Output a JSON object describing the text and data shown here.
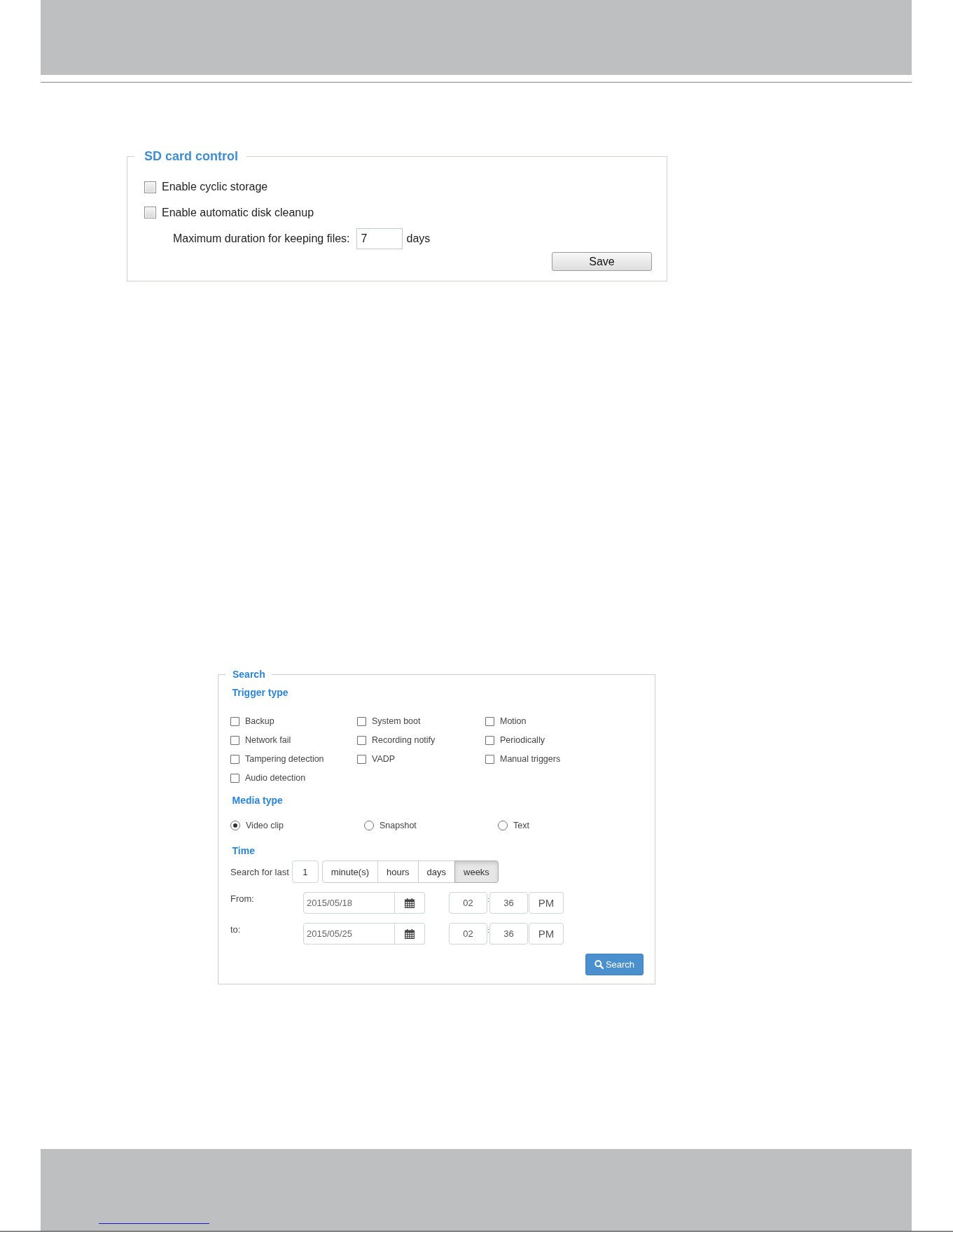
{
  "sd_card": {
    "title": "SD card control",
    "options": [
      {
        "label": "Enable cyclic storage",
        "checked": false
      },
      {
        "label": "Enable automatic disk cleanup",
        "checked": false
      }
    ],
    "max_duration": {
      "label": "Maximum duration for keeping files:",
      "value": "7",
      "unit": "days"
    },
    "save_button": "Save"
  },
  "search": {
    "title": "Search",
    "trigger_type": {
      "title": "Trigger type",
      "options": [
        {
          "label": "Backup",
          "checked": false
        },
        {
          "label": "System boot",
          "checked": false
        },
        {
          "label": "Motion",
          "checked": false
        },
        {
          "label": "Network fail",
          "checked": false
        },
        {
          "label": "Recording notify",
          "checked": false
        },
        {
          "label": "Periodically",
          "checked": false
        },
        {
          "label": "Tampering detection",
          "checked": false
        },
        {
          "label": "VADP",
          "checked": false
        },
        {
          "label": "Manual triggers",
          "checked": false
        },
        {
          "label": "Audio detection",
          "checked": false
        }
      ]
    },
    "media_type": {
      "title": "Media type",
      "options": [
        {
          "label": "Video clip",
          "selected": true
        },
        {
          "label": "Snapshot",
          "selected": false
        },
        {
          "label": "Text",
          "selected": false
        }
      ]
    },
    "time": {
      "title": "Time",
      "search_for_last": {
        "label": "Search for last",
        "value": "1",
        "units": [
          {
            "label": "minute(s)",
            "selected": false
          },
          {
            "label": "hours",
            "selected": false
          },
          {
            "label": "days",
            "selected": false
          },
          {
            "label": "weeks",
            "selected": true
          }
        ]
      },
      "ranges": [
        {
          "label": "From:",
          "date": "2015/05/18",
          "hour": "02",
          "separator": ":",
          "minute": "36",
          "period": "PM"
        },
        {
          "label": "to:",
          "date": "2015/05/25",
          "hour": "02",
          "separator": ":",
          "minute": "36",
          "period": "PM"
        }
      ]
    },
    "search_button": "Search"
  }
}
